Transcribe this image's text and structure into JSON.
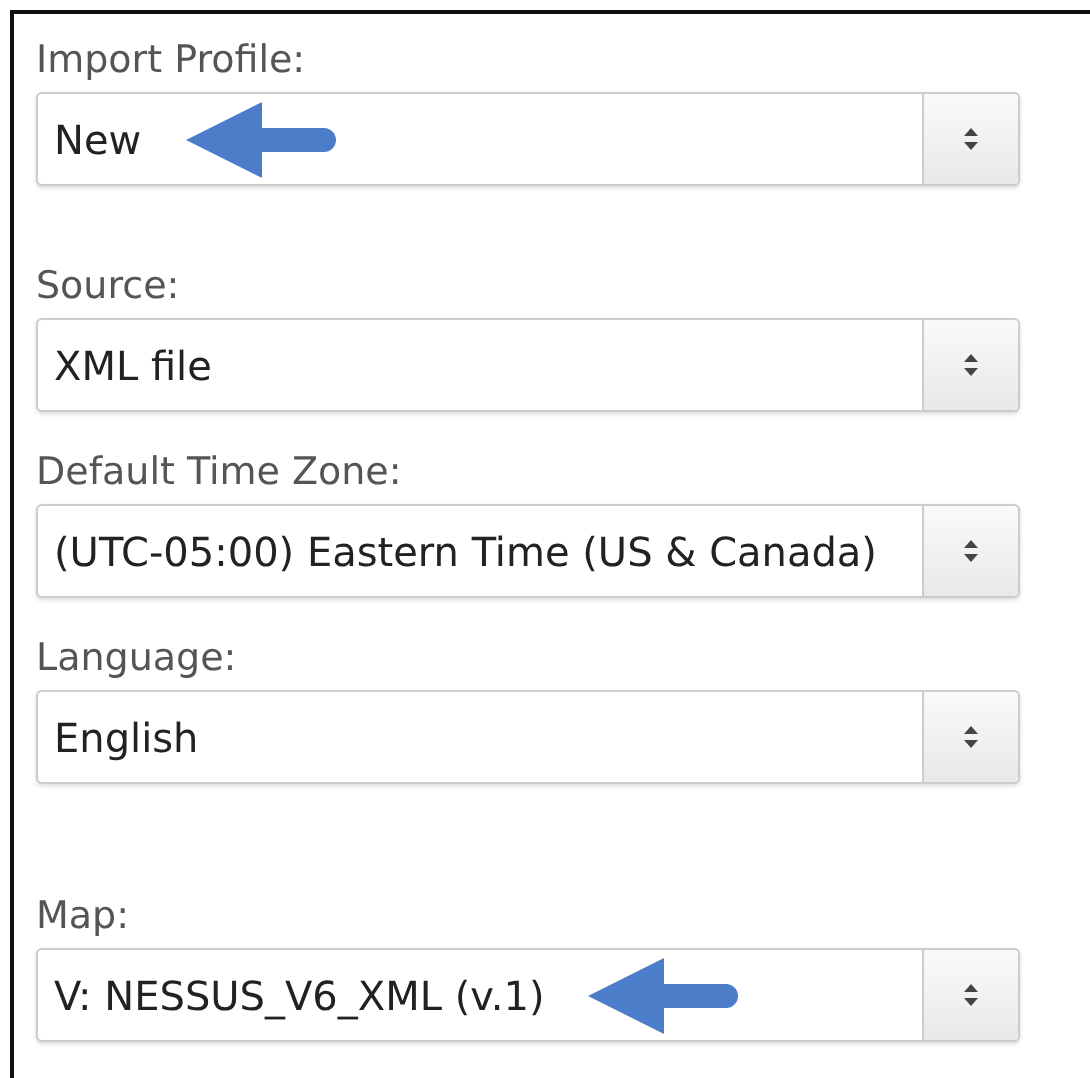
{
  "fields": [
    {
      "label": "Import Profile:",
      "value": "New",
      "arrow": true
    },
    {
      "label": "Source:",
      "value": "XML file",
      "arrow": false
    },
    {
      "label": "Default Time Zone:",
      "value": "(UTC-05:00) Eastern Time (US & Canada)",
      "arrow": false
    },
    {
      "label": "Language:",
      "value": "English",
      "arrow": false
    },
    {
      "label": "Map:",
      "value": "V: NESSUS_V6_XML (v.1)",
      "arrow": true
    }
  ]
}
